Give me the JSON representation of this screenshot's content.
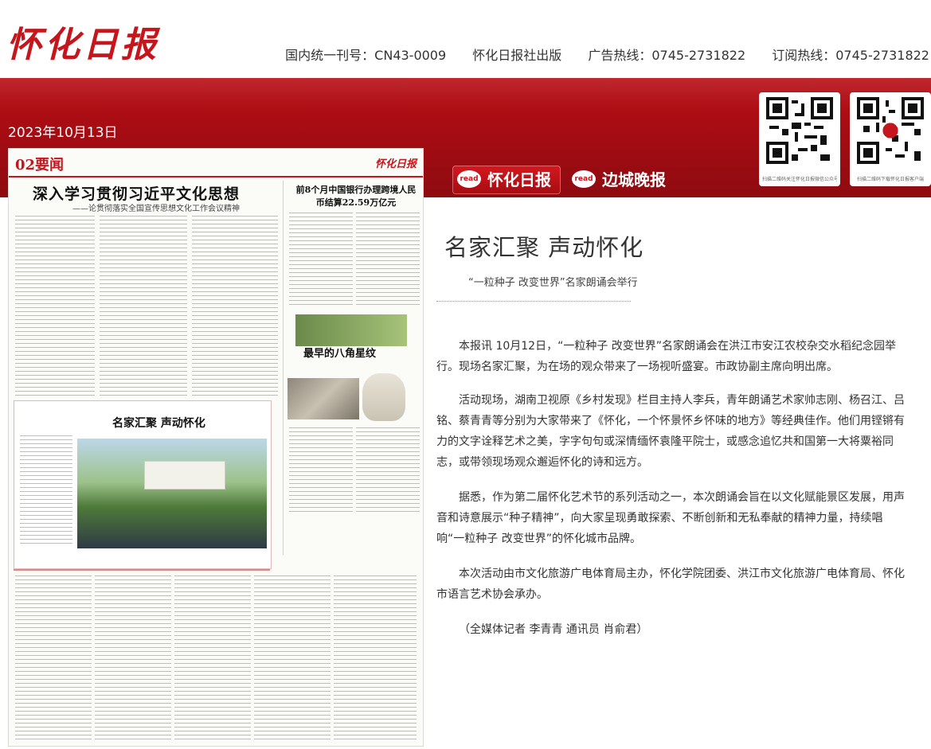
{
  "header": {
    "logo_text": "怀化日报",
    "info": [
      "国内统一刊号：CN43-0009",
      "怀化日报社出版",
      "广告热线：0745-2731822",
      "订阅热线：0745-2731822"
    ]
  },
  "banner": {
    "date": "2023年10月13日",
    "brands": [
      {
        "tag": "read",
        "name": "怀化日报"
      },
      {
        "tag": "read",
        "name": "边城晚报"
      }
    ],
    "qr_captions": [
      "扫描二维码关注怀化日报微信公众号",
      "扫描二维码下载怀化日报客户端"
    ]
  },
  "newspaper": {
    "page_label": "02要闻",
    "logo": "怀化日报",
    "headline_1": "深入学习贯彻习近平文化思想",
    "subhead_1": "——论贯彻落实全国宣传思想文化工作会议精神",
    "headline_2": "前8个月中国银行办理跨境人民币结算22.59万亿元",
    "headline_3": "最早的八角星纹",
    "feature_title": "名家汇聚 声动怀化"
  },
  "article": {
    "title": "名家汇聚 声动怀化",
    "subtitle": "“一粒种子 改变世界”名家朗诵会举行",
    "paragraphs": [
      "本报讯 10月12日，“一粒种子 改变世界”名家朗诵会在洪江市安江农校杂交水稻纪念园举行。现场名家汇聚，为在场的观众带来了一场视听盛宴。市政协副主席向明出席。",
      "活动现场，湖南卫视原《乡村发现》栏目主持人李兵，青年朗诵艺术家帅志刚、杨召江、吕铭、蔡青青等分别为大家带来了《怀化，一个怀景怀乡怀味的地方》等经典佳作。他们用铿锵有力的文字诠释艺术之美，字字句句或深情缅怀袁隆平院士，或感念追忆共和国第一大将粟裕同志，或带领现场观众邂逅怀化的诗和远方。",
      "据悉，作为第二届怀化艺术节的系列活动之一，本次朗诵会旨在以文化赋能景区发展，用声音和诗意展示“种子精神”，向大家呈现勇敢探索、不断创新和无私奉献的精神力量，持续唱响“一粒种子 改变世界”的怀化城市品牌。",
      "本次活动由市文化旅游广电体育局主办，怀化学院团委、洪江市文化旅游广电体育局、怀化市语言艺术协会承办。",
      "（全媒体记者 李青青 通讯员 肖俞君）"
    ]
  }
}
